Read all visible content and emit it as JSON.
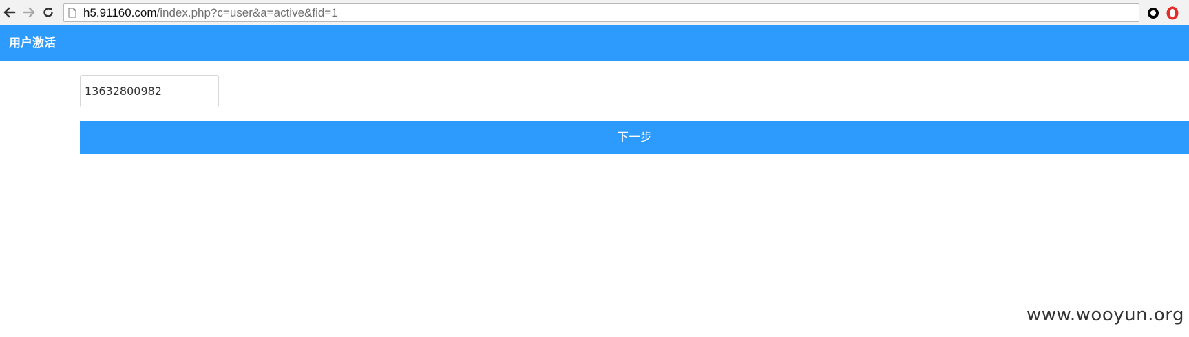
{
  "browser": {
    "url_host": "h5.91160.com",
    "url_path": "/index.php?c=user&a=active&fid=1",
    "icons": [
      "back-arrow-icon",
      "forward-arrow-icon",
      "reload-icon",
      "page-icon",
      "extension-icon",
      "opera-icon"
    ]
  },
  "header": {
    "title": "用户激活",
    "color": "#2d9afe"
  },
  "form": {
    "phone_value": "13632800982",
    "next_label": "下一步"
  },
  "watermark": {
    "text": "www.wooyun.org"
  }
}
